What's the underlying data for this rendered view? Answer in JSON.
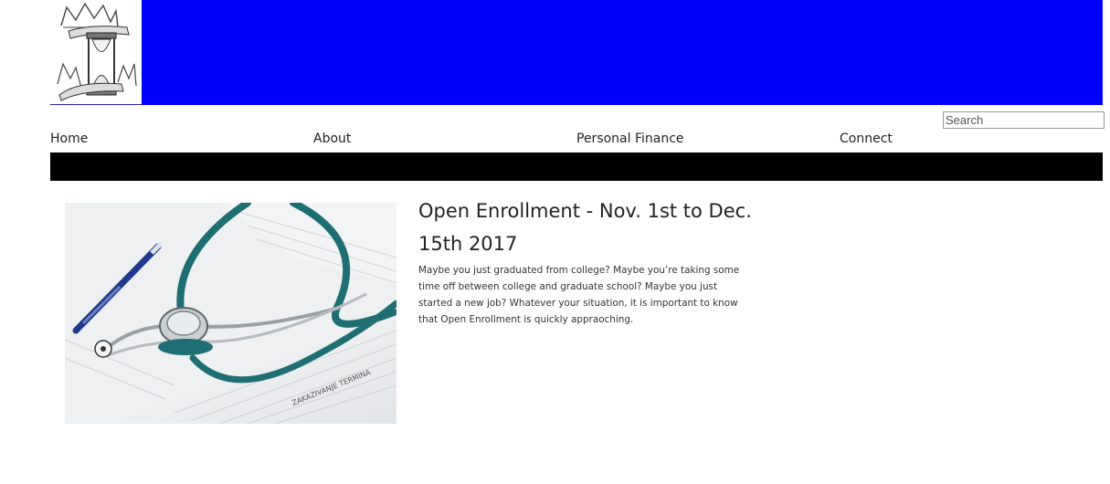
{
  "colors": {
    "banner": "#0000ff",
    "nav_bar": "#000000",
    "page_background": "#ffffff",
    "stethoscope_tube": "#1e6e73"
  },
  "header": {
    "logo_icon": "crowned-hourglass-logo",
    "search": {
      "placeholder": "Search",
      "value": ""
    }
  },
  "nav": {
    "items": [
      {
        "label": "Home"
      },
      {
        "label": "About"
      },
      {
        "label": "Personal Finance"
      },
      {
        "label": "Connect"
      }
    ]
  },
  "post": {
    "image_icon": "stethoscope-on-forms-photo",
    "title": "Open Enrollment - Nov. 1st to Dec. 15th 2017",
    "excerpt": "Maybe you just graduated from college? Maybe you’re taking some time off between college and graduate school? Maybe you just started a new job? Whatever your situation, it is important to know that Open Enrollment is quickly appraoching."
  }
}
